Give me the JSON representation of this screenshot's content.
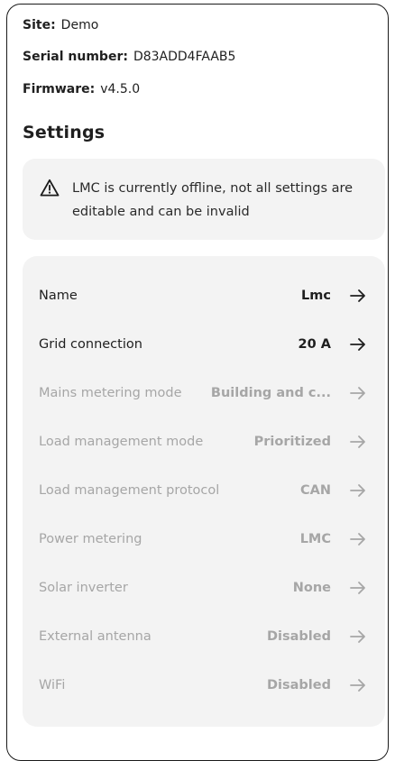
{
  "device": {
    "site_key": "Site:",
    "site_value": "Demo",
    "serial_key": "Serial number:",
    "serial_value": "D83ADD4FAAB5",
    "firmware_key": "Firmware:",
    "firmware_value": "v4.5.0"
  },
  "settings": {
    "title": "Settings",
    "warning": {
      "icon": "warning-triangle-icon",
      "text": "LMC is currently offline, not all settings are editable and can be invalid"
    },
    "items": [
      {
        "label": "Name",
        "value": "Lmc",
        "enabled": true
      },
      {
        "label": "Grid connection",
        "value": "20 A",
        "enabled": true
      },
      {
        "label": "Mains metering mode",
        "value": "Building and c...",
        "enabled": false
      },
      {
        "label": "Load management mode",
        "value": "Prioritized",
        "enabled": false
      },
      {
        "label": "Load management protocol",
        "value": "CAN",
        "enabled": false
      },
      {
        "label": "Power metering",
        "value": "LMC",
        "enabled": false
      },
      {
        "label": "Solar inverter",
        "value": "None",
        "enabled": false
      },
      {
        "label": "External antenna",
        "value": "Disabled",
        "enabled": false
      },
      {
        "label": "WiFi",
        "value": "Disabled",
        "enabled": false
      }
    ]
  },
  "colors": {
    "text": "#1f1f1f",
    "disabled_text": "#a6a6a6",
    "card_bg": "#f3f3f3"
  }
}
